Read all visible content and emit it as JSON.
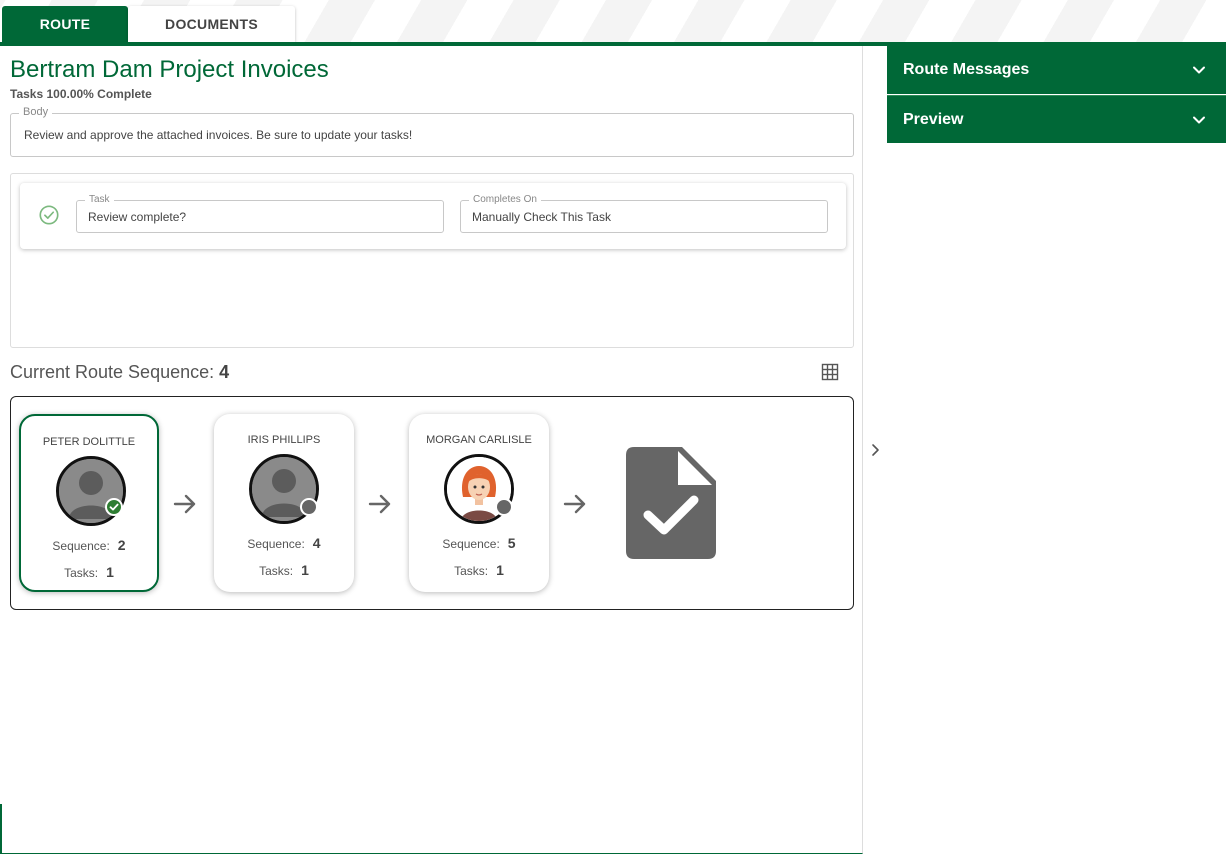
{
  "tabs": [
    {
      "label": "ROUTE"
    },
    {
      "label": "DOCUMENTS"
    }
  ],
  "route": {
    "title": "Bertram Dam Project Invoices",
    "progress": "Tasks 100.00% Complete",
    "body": {
      "legend": "Body",
      "value": "Review and approve the attached invoices. Be sure to update your tasks!"
    },
    "task": {
      "task_legend": "Task",
      "task_value": "Review complete?",
      "completes_legend": "Completes On",
      "completes_value": "Manually Check This Task",
      "status_icon": "check-circle-icon"
    },
    "sequence_label": "Current Route Sequence:",
    "current_sequence": "4",
    "participants": [
      {
        "name": "PETER DOLITTLE",
        "sequence_label": "Sequence:",
        "sequence": "2",
        "tasks_label": "Tasks:",
        "tasks": "1",
        "status": "complete"
      },
      {
        "name": "IRIS PHILLIPS",
        "sequence_label": "Sequence:",
        "sequence": "4",
        "tasks_label": "Tasks:",
        "tasks": "1",
        "status": "pending"
      },
      {
        "name": "MORGAN CARLISLE",
        "sequence_label": "Sequence:",
        "sequence": "5",
        "tasks_label": "Tasks:",
        "tasks": "1",
        "status": "pending"
      }
    ]
  },
  "side_panels": [
    {
      "label": "Route Messages"
    },
    {
      "label": "Preview"
    }
  ],
  "colors": {
    "brand_green": "#006837",
    "complete_green": "#2e7d32",
    "pending_gray": "#666666"
  }
}
